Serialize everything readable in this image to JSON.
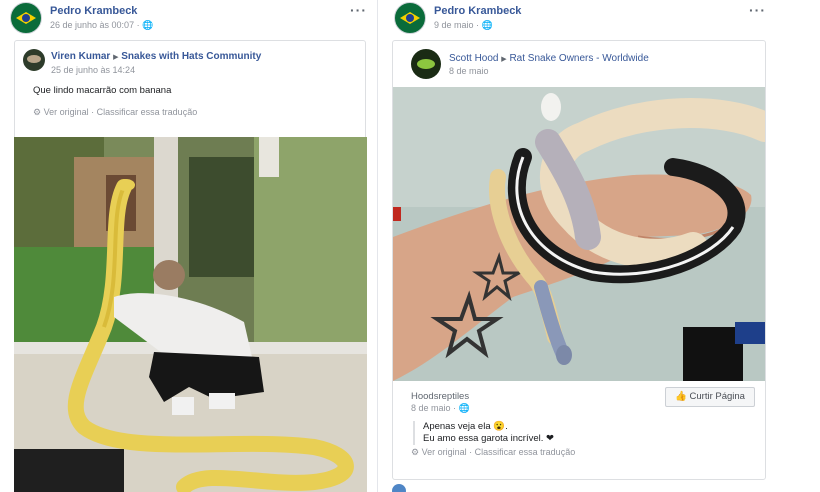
{
  "left_post": {
    "author": "Pedro Krambeck",
    "date": "26 de junho às 00:07",
    "privacy_icon": "globe-icon",
    "shared": {
      "author": "Viren Kumar",
      "arrow": "▶",
      "group": "Snakes with Hats Community",
      "date": "25 de junho às 14:24",
      "text": "Que lindo macarrão com banana",
      "see_original": "Ver original",
      "separator": "·",
      "rate_translation": "Classificar essa tradução"
    }
  },
  "right_post": {
    "author": "Pedro Krambeck",
    "date": "9 de maio",
    "privacy_icon": "globe-icon",
    "shared": {
      "author": "Scott Hood",
      "arrow": "▶",
      "group": "Rat Snake Owners - Worldwide",
      "date": "8 de maio",
      "page_name": "Hoodsreptiles",
      "page_date": "8 de maio",
      "like_page_label": "Curtir Página",
      "quote_line1": "Apenas veja ela 😮.",
      "quote_line2": "Eu amo essa garota incrível. ❤",
      "see_original": "Ver original",
      "separator": "·",
      "rate_translation": "Classificar essa tradução"
    }
  },
  "colors": {
    "link_blue": "#385898",
    "meta_gray": "#90949c",
    "python_yellow": "#e8cf55",
    "heart_red": "#e0245e"
  },
  "more_icon": "more-options-icon"
}
